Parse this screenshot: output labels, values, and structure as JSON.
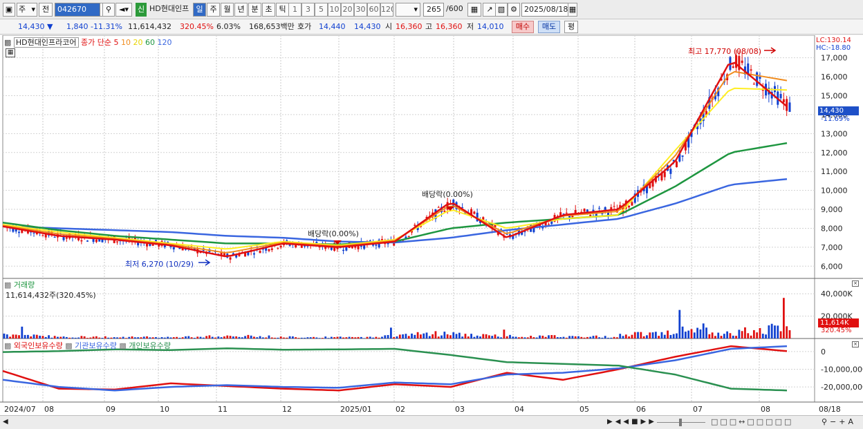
{
  "toolbar": {
    "type_select": "주",
    "prev_label": "전",
    "code": "042670",
    "new_badge": "신",
    "stock_name": "HD현대인프",
    "periods": [
      "일",
      "주",
      "월",
      "년",
      "분",
      "초",
      "틱"
    ],
    "active_period": "일",
    "intervals": [
      "1",
      "3",
      "5",
      "10",
      "20",
      "30",
      "60",
      "120"
    ],
    "count_value": "265",
    "count_max": "/600",
    "date": "2025/08/18"
  },
  "quote": {
    "price": "14,430",
    "change": "1,840",
    "change_pct": "-11.31%",
    "volume": "11,614,432",
    "volume_ratio": "320.45%",
    "turnover": "6.03%",
    "amount": "168,653백만",
    "hoga_label": "호가",
    "ask": "14,440",
    "bid": "14,430",
    "open_label": "시",
    "open": "16,360",
    "high_label": "고",
    "high": "16,360",
    "low_label": "저",
    "low": "14,010",
    "buy_label": "매수",
    "sell_label": "매도",
    "eval_label": "평"
  },
  "price_panel": {
    "legend_name": "HD현대인프라코어",
    "legend_ma_label": "종가 단순",
    "legend_periods": [
      "5",
      "10",
      "20",
      "60",
      "120"
    ],
    "lc": "LC:130.14",
    "hc": "HC:-18.80",
    "last_price_tag": "14,430",
    "last_change_tag": "-11.69%",
    "high_note": "최고 17,770 (08/08)",
    "low_note": "최저 6,270 (10/29)",
    "dividend_note_1": "배당락(0.00%)",
    "dividend_note_2": "배당락(0.00%)"
  },
  "volume_panel": {
    "title": "거래량",
    "value": "11,614,432주(320.45%)",
    "last_tag": "11,614K",
    "last_pct_tag": "320.45%"
  },
  "holding_panel": {
    "legend": [
      "외국인보유수량",
      "기관보유수량",
      "개인보유수량"
    ]
  },
  "x_axis": [
    "2024/07",
    "08",
    "09",
    "10",
    "11",
    "12",
    "2025/01",
    "02",
    "03",
    "04",
    "05",
    "06",
    "07",
    "08",
    "08/18"
  ],
  "colors": {
    "up": "#e01010",
    "down": "#1040d0",
    "ma5": "#e01010",
    "ma10": "#f08c1e",
    "ma20": "#ffee22",
    "ma60": "#1e9640",
    "ma120": "#3a66e0",
    "foreign": "#e01010",
    "institution": "#3a66e0",
    "individual": "#2a9050",
    "tag_bg": "#1e50c8"
  },
  "chart_data": [
    {
      "type": "line",
      "title": "HD현대인프라코어",
      "ylabel": "",
      "ylim": [
        5500,
        17900
      ],
      "y_ticks": [
        "6,000",
        "7,000",
        "8,000",
        "9,000",
        "10,000",
        "11,000",
        "12,000",
        "13,000",
        "14,000",
        "15,000",
        "16,000",
        "17,000"
      ],
      "x": [
        "2024/07",
        "08",
        "09",
        "10",
        "11",
        "12",
        "2025/01",
        "02",
        "03",
        "04",
        "05",
        "06",
        "07",
        "08",
        "08/18"
      ],
      "series": [
        {
          "name": "5",
          "values": [
            8100,
            7600,
            7400,
            7100,
            6500,
            7200,
            7000,
            7300,
            9400,
            7500,
            8700,
            9000,
            11500,
            16900,
            14430
          ]
        },
        {
          "name": "10",
          "values": [
            8150,
            7700,
            7450,
            7150,
            6700,
            7250,
            7050,
            7350,
            9250,
            7700,
            8650,
            8900,
            11800,
            16300,
            15800
          ]
        },
        {
          "name": "20",
          "values": [
            8200,
            7800,
            7500,
            7200,
            6900,
            7300,
            7100,
            7400,
            9000,
            8000,
            8500,
            8700,
            12100,
            15400,
            15300
          ]
        },
        {
          "name": "60",
          "values": [
            8300,
            7900,
            7600,
            7400,
            7200,
            7200,
            7150,
            7300,
            8000,
            8300,
            8500,
            8700,
            10200,
            12000,
            12500
          ]
        },
        {
          "name": "120",
          "values": [
            8100,
            8000,
            7900,
            7800,
            7600,
            7500,
            7300,
            7250,
            7500,
            7900,
            8200,
            8500,
            9300,
            10300,
            10600
          ]
        }
      ]
    },
    {
      "type": "bar",
      "title": "거래량",
      "ylim": [
        0,
        50000
      ],
      "y_ticks": [
        "20,000K",
        "40,000K"
      ],
      "categories": [
        "2024/07",
        "08",
        "09",
        "10",
        "11",
        "12",
        "2025/01",
        "02",
        "03",
        "04",
        "05",
        "06",
        "07",
        "08"
      ],
      "values": [
        4000,
        2000,
        1500,
        1500,
        2500,
        1500,
        1200,
        6000,
        3000,
        2500,
        2000,
        9000,
        7000,
        11614
      ]
    },
    {
      "type": "line",
      "title": "보유수량",
      "ylim": [
        -27000000,
        5000000
      ],
      "y_ticks": [
        "0",
        "-10,000,000",
        "-20,000,000"
      ],
      "x": [
        "2024/07",
        "08",
        "09",
        "10",
        "11",
        "12",
        "2025/01",
        "02",
        "03",
        "04",
        "05",
        "06",
        "07",
        "08",
        "08/18"
      ],
      "series": [
        {
          "name": "외국인보유수량",
          "values": [
            -11000000,
            -21000000,
            -21500000,
            -18000000,
            -19500000,
            -21000000,
            -22000000,
            -18500000,
            -20000000,
            -12000000,
            -16000000,
            -10000000,
            -3000000,
            3000000,
            200000
          ]
        },
        {
          "name": "기관보유수량",
          "values": [
            -16000000,
            -20000000,
            -22000000,
            -20000000,
            -19000000,
            -20000000,
            -20500000,
            -17500000,
            -18500000,
            -13000000,
            -12000000,
            -9500000,
            -5000000,
            1500000,
            3000000
          ]
        },
        {
          "name": "개인보유수량",
          "values": [
            -300000,
            200000,
            1200000,
            800000,
            1800000,
            1000000,
            1200000,
            1500000,
            -2000000,
            -6000000,
            -7000000,
            -8000000,
            -13000000,
            -21000000,
            -22000000
          ]
        }
      ]
    }
  ]
}
